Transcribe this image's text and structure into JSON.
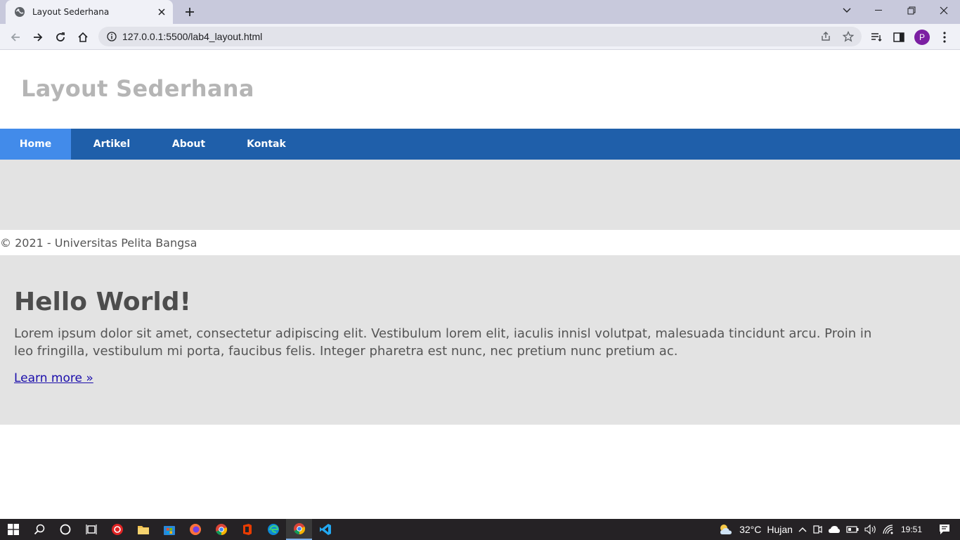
{
  "browser": {
    "tab_title": "Layout Sederhana",
    "url": "127.0.0.1:5500/lab4_layout.html",
    "profile_initial": "P"
  },
  "page": {
    "site_title": "Layout Sederhana",
    "nav": [
      {
        "label": "Home",
        "active": true
      },
      {
        "label": "Artikel",
        "active": false
      },
      {
        "label": "About",
        "active": false
      },
      {
        "label": "Kontak",
        "active": false
      }
    ],
    "footer_text": "© 2021 - Universitas Pelita Bangsa",
    "hero": {
      "heading": "Hello World!",
      "body": "Lorem ipsum dolor sit amet, consectetur adipiscing elit. Vestibulum lorem elit, iaculis innisl volutpat, malesuada tincidunt arcu. Proin in leo fringilla, vestibulum mi porta, faucibus felis. Integer pharetra est nunc, nec pretium nunc pretium ac.",
      "link": "Learn more »"
    }
  },
  "taskbar": {
    "weather_temp": "32°C",
    "weather_text": "Hujan",
    "clock": "19:51"
  },
  "colors": {
    "nav_bg": "#1f5faa",
    "nav_active": "#428bea",
    "band_grey": "#e3e3e3",
    "title_grey": "#b5b5b5",
    "profile": "#7b1fa2"
  }
}
